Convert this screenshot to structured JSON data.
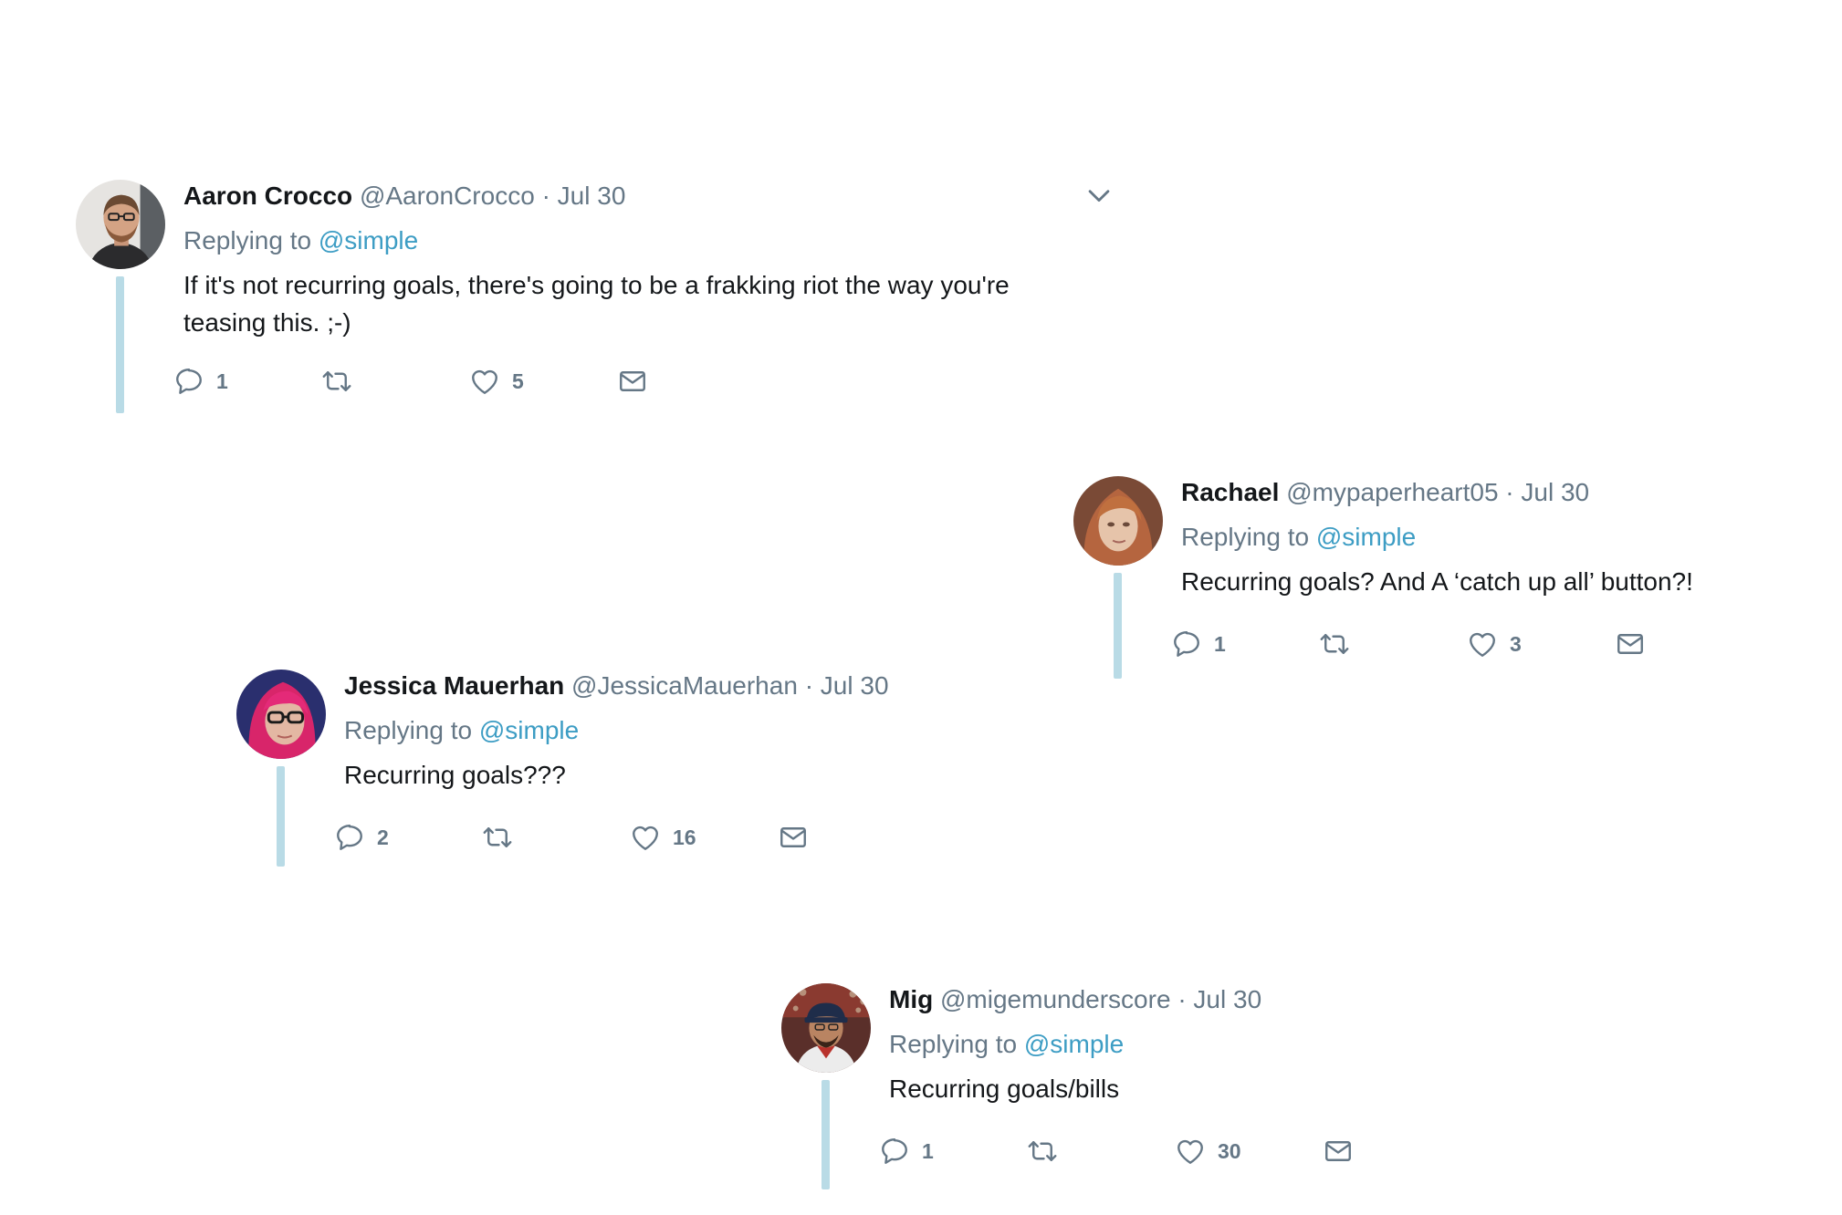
{
  "replying_prefix": "Replying to",
  "tweets": [
    {
      "name": "Aaron Crocco",
      "handle": "@AaronCrocco",
      "dot": "·",
      "date": "Jul 30",
      "reply_handle": "@simple",
      "text": "If it's not recurring goals, there's going to be a frakking riot the way you're teasing this. ;-)",
      "replies": "1",
      "likes": "5"
    },
    {
      "name": "Rachael",
      "handle": "@mypaperheart05",
      "dot": "·",
      "date": "Jul 30",
      "reply_handle": "@simple",
      "text": "Recurring goals? And A ‘catch up all’ button?!",
      "replies": "1",
      "likes": "3"
    },
    {
      "name": "Jessica Mauerhan",
      "handle": "@JessicaMauerhan",
      "dot": "·",
      "date": "Jul 30",
      "reply_handle": "@simple",
      "text": "Recurring goals???",
      "replies": "2",
      "likes": "16"
    },
    {
      "name": "Mig",
      "handle": "@migemunderscore",
      "dot": "·",
      "date": "Jul 30",
      "reply_handle": "@simple",
      "text": "Recurring goals/bills",
      "replies": "1",
      "likes": "30"
    }
  ],
  "icons": {
    "reply": "reply-icon",
    "retweet": "retweet-icon",
    "like": "heart-icon",
    "message": "envelope-icon",
    "more": "chevron-down-icon"
  },
  "colors": {
    "link": "#3d9dc4",
    "secondary_text": "#657786",
    "thread_line": "#b9dbe6",
    "primary_text": "#14171a"
  }
}
